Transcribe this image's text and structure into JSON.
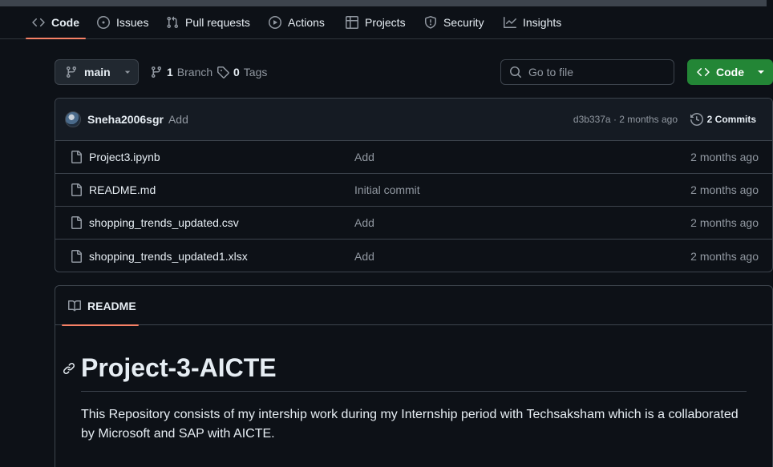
{
  "nav": {
    "tabs": [
      {
        "label": "Code",
        "icon": "code-icon",
        "selected": true
      },
      {
        "label": "Issues",
        "icon": "issue-icon"
      },
      {
        "label": "Pull requests",
        "icon": "pull-request-icon"
      },
      {
        "label": "Actions",
        "icon": "play-icon"
      },
      {
        "label": "Projects",
        "icon": "table-icon"
      },
      {
        "label": "Security",
        "icon": "shield-icon"
      },
      {
        "label": "Insights",
        "icon": "graph-icon"
      }
    ]
  },
  "toolbar": {
    "branch": "main",
    "branches_count": "1",
    "branches_label": "Branch",
    "tags_count": "0",
    "tags_label": "Tags",
    "search_placeholder": "Go to file",
    "code_label": "Code"
  },
  "commit": {
    "author": "Sneha2006sgr",
    "message": "Add",
    "hash_time": "d3b337a · 2 months ago",
    "count_label": "2 Commits"
  },
  "files": [
    {
      "name": "Project3.ipynb",
      "message": "Add",
      "date": "2 months ago"
    },
    {
      "name": "README.md",
      "message": "Initial commit",
      "date": "2 months ago"
    },
    {
      "name": "shopping_trends_updated.csv",
      "message": "Add",
      "date": "2 months ago"
    },
    {
      "name": "shopping_trends_updated1.xlsx",
      "message": "Add",
      "date": "2 months ago"
    }
  ],
  "readme": {
    "tab_label": "README",
    "title": "Project-3-AICTE",
    "body": "This Repository consists of my intership work during my Internship period with Techsaksham which is a collaborated by Microsoft and SAP with AICTE."
  },
  "colors": {
    "background": "#0d1117",
    "accent_underline": "#f78166",
    "primary_button": "#238636",
    "border": "#3d444d"
  }
}
